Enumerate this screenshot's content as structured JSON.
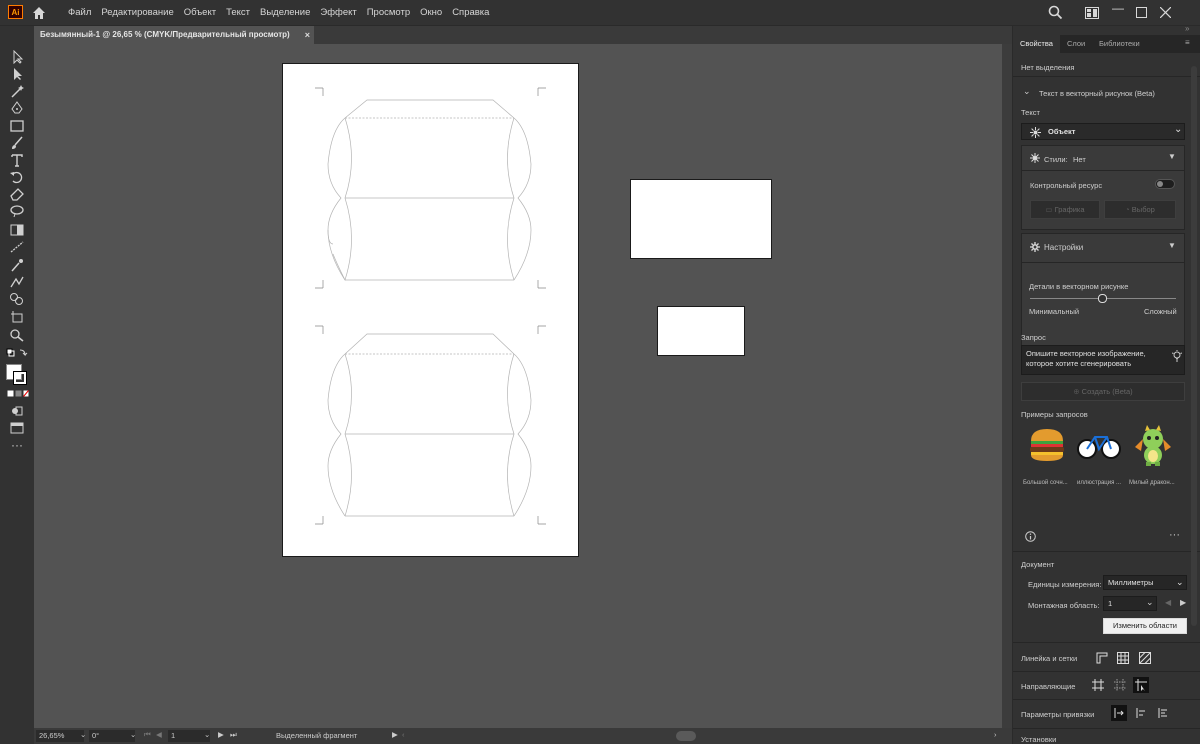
{
  "app": {
    "logo_text": "Ai"
  },
  "menu": [
    "Файл",
    "Редактирование",
    "Объект",
    "Текст",
    "Выделение",
    "Эффект",
    "Просмотр",
    "Окно",
    "Справка"
  ],
  "document_tab": {
    "title": "Безымянный-1 @ 26,65 % (CMYK/Предварительный просмотр)",
    "close": "×"
  },
  "status": {
    "zoom": "26,65%",
    "rotation": "0°",
    "artboard": "1",
    "mode": "Выделенный фрагмент"
  },
  "panel": {
    "tabs": [
      "Свойства",
      "Слои",
      "Библиотеки"
    ],
    "no_selection": "Нет выделения",
    "section_title": "Текст в векторный рисунок (Beta)",
    "text_label": "Текст",
    "type_value": "Объект",
    "styles_label": "Стили:",
    "styles_value": "Нет",
    "control_resource": "Контрольный ресурс",
    "graphics_btn": "Графика",
    "choice_btn": "Выбор",
    "settings_label": "Настройки",
    "detail_label": "Детали в векторном рисунке",
    "detail_min": "Минимальный",
    "detail_max": "Сложный",
    "detail_level": 0.5,
    "prompt_label": "Запрос",
    "prompt_placeholder": "Опишите векторное изображение, которое хотите сгенерировать",
    "create_btn": "Создать (Beta)",
    "examples_label": "Примеры запросов",
    "examples": [
      "Большой сочн...",
      "иллюстрация ...",
      "Милый дракон..."
    ],
    "document_label": "Документ",
    "units_label": "Единицы измерения:",
    "units_value": "Миллиметры",
    "artboard_label": "Монтажная область:",
    "artboard_value": "1",
    "edit_artboards_btn": "Изменить области",
    "rulers_label": "Линейка и сетки",
    "guides_label": "Направляющие",
    "snap_label": "Параметры привязки",
    "settings_cut": "Установки"
  }
}
